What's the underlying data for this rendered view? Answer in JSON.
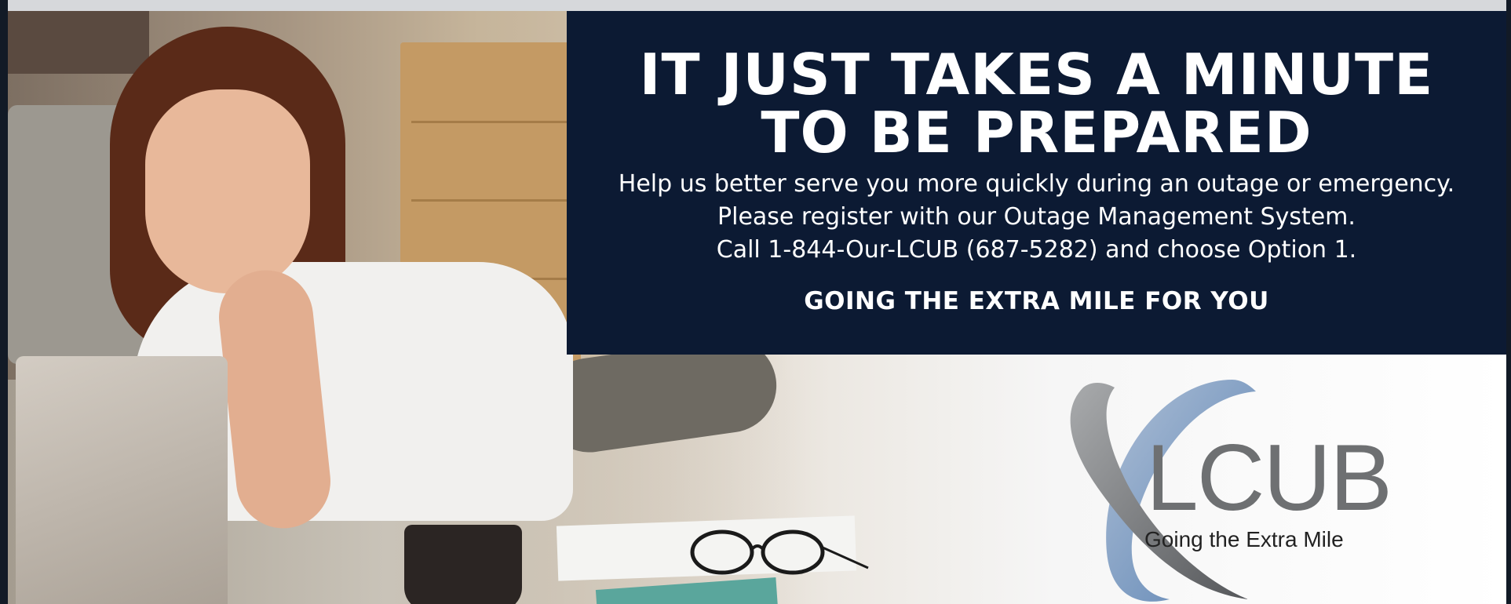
{
  "panel": {
    "headline_line1": "IT JUST TAKES A MINUTE",
    "headline_line2": "TO BE PREPARED",
    "body_line1": "Help us better serve you more quickly during an outage or emergency.",
    "body_line2": "Please register with our Outage Management System.",
    "body_line3": "Call 1-844-Our-LCUB (687-5282) and choose Option 1.",
    "tagline": "GOING THE EXTRA MILE FOR YOU",
    "background_color": "#0c1a33",
    "text_color": "#ffffff"
  },
  "logo": {
    "wordmark": "LCUB",
    "slogan": "Going the Extra Mile",
    "swoosh_colors": [
      "#5b83b3",
      "#7b7d80"
    ]
  },
  "photo": {
    "icon": "woman-with-laptop-photo"
  }
}
